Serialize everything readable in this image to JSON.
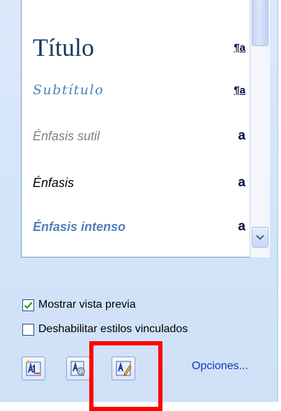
{
  "styles_list": {
    "items": [
      {
        "name": "Título",
        "mark": "¶a"
      },
      {
        "name": "Subtítulo",
        "mark": "¶a"
      },
      {
        "name": "Énfasis sutil",
        "mark": "a"
      },
      {
        "name": "Énfasis",
        "mark": "a"
      },
      {
        "name": "Énfasis intenso",
        "mark": "a"
      }
    ]
  },
  "options": {
    "show_preview": {
      "label": "Mostrar vista previa",
      "checked": true
    },
    "disable_linked": {
      "label": "Deshabilitar estilos vinculados",
      "checked": false
    }
  },
  "toolbar": {
    "buttons": [
      {
        "icon": "new-style-icon"
      },
      {
        "icon": "style-inspector-icon"
      },
      {
        "icon": "manage-styles-icon"
      }
    ],
    "options_link": "Opciones..."
  },
  "colors": {
    "pane_bg": "#d6e5fa",
    "link": "#0b3bb7",
    "title_style": "#17365d",
    "accent_style": "#4f81bd",
    "subtle_style": "#808080",
    "highlight_box": "#ff0000"
  }
}
